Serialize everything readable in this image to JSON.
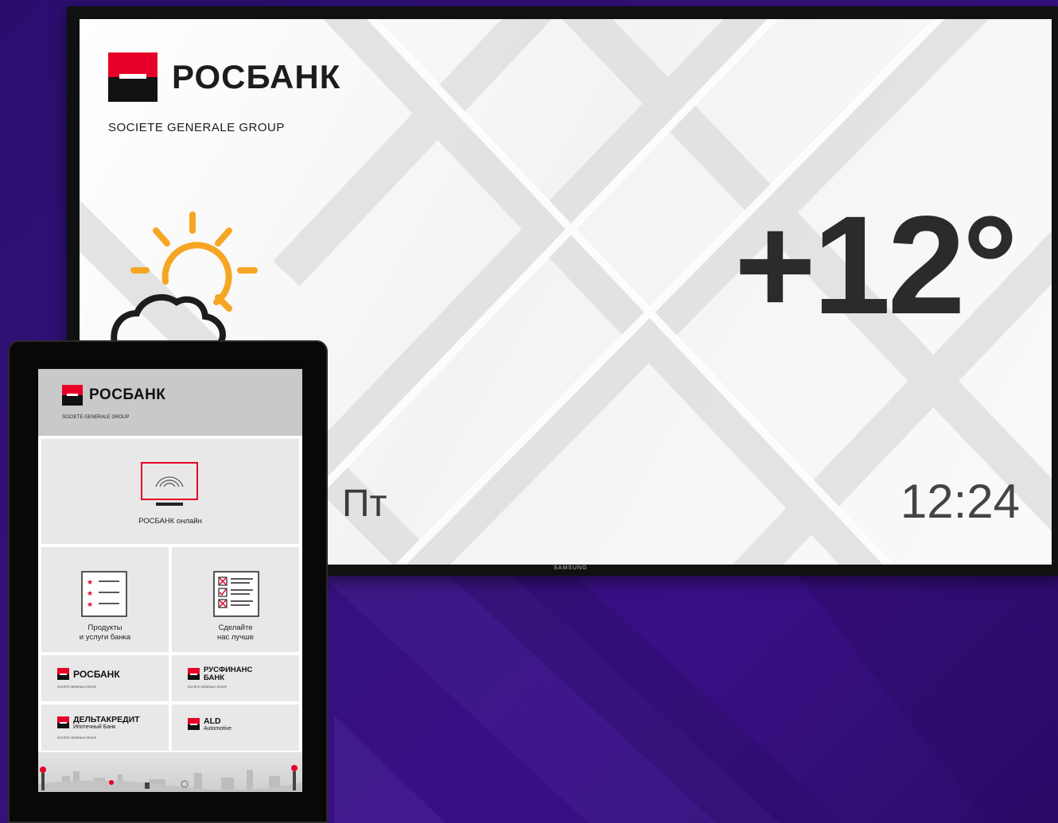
{
  "tv": {
    "brand": "РОСБАНК",
    "group": "SOCIETE GENERALE GROUP",
    "temperature": "+12°",
    "day": "Пт",
    "time": "12:24",
    "maker": "SAMSUNG",
    "weather_icon": "sun-behind-cloud-icon"
  },
  "tablet": {
    "brand": "РОСБАНК",
    "group": "SOCIETE GENERALE GROUP",
    "tiles": {
      "online": {
        "label": "РОСБАНК онлайн",
        "icon": "monitor-signal-icon"
      },
      "products": {
        "label_line1": "Продукты",
        "label_line2": "и услуги банка",
        "icon": "star-list-icon"
      },
      "feedback": {
        "label_line1": "Сделайте",
        "label_line2": "нас лучше",
        "icon": "checklist-icon"
      }
    },
    "partners": {
      "rosbank": {
        "name": "РОСБАНК",
        "group": "SOCIETE GENERALE GROUP"
      },
      "rusfinance": {
        "name_line1": "РУСФИНАНС",
        "name_line2": "БАНК",
        "group": "SOCIETE GENERALE GROUP"
      },
      "deltacredit": {
        "name": "ДЕЛЬТАКРЕДИТ",
        "sub": "Ипотечный Банк",
        "group": "SOCIETE GENERALE GROUP"
      },
      "ald": {
        "name": "ALD",
        "sub": "Automotive"
      }
    }
  },
  "colors": {
    "brand_red": "#e60028",
    "brand_black": "#111111",
    "background": "#34117a"
  }
}
